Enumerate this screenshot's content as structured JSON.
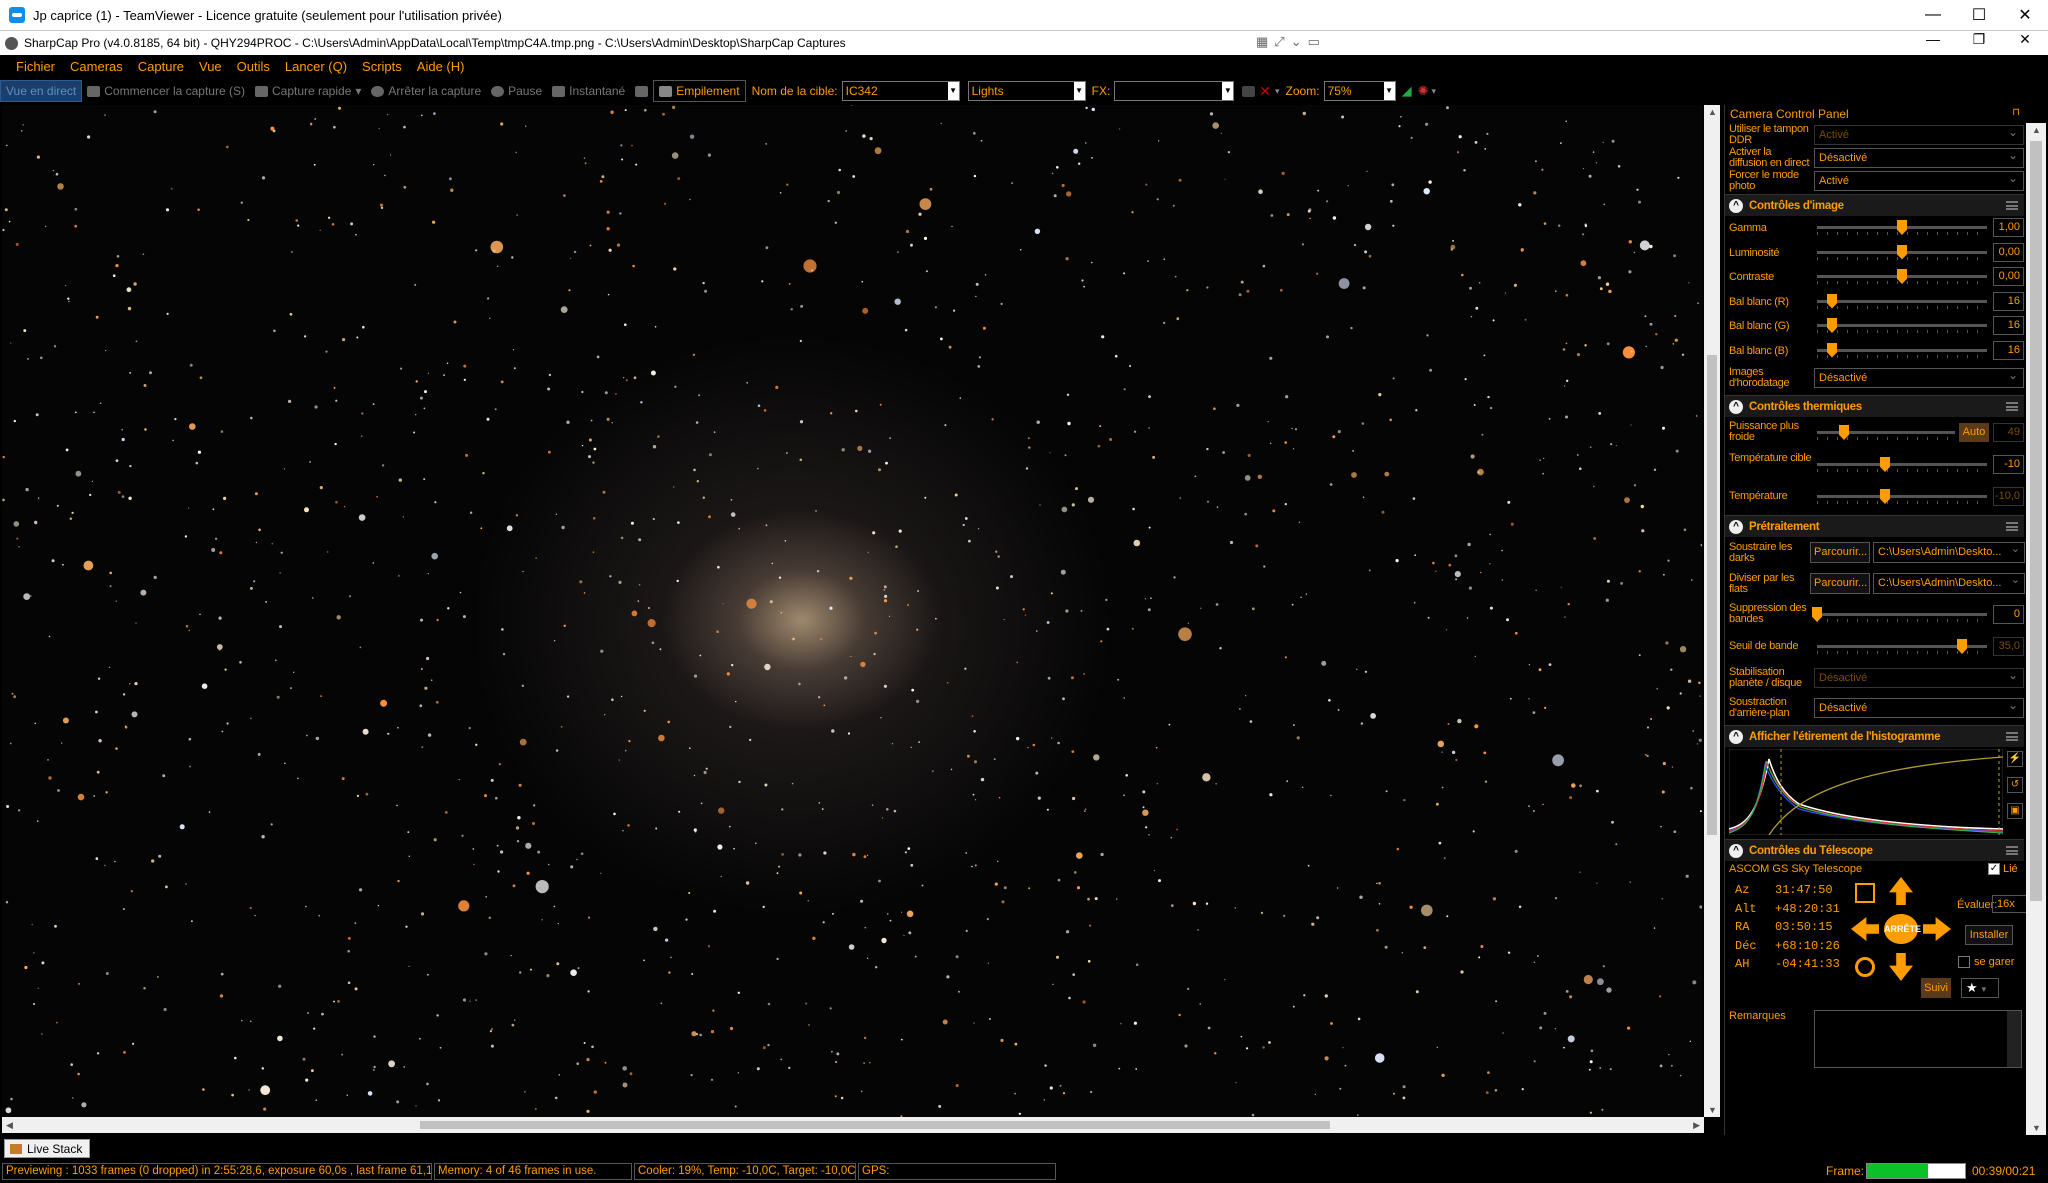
{
  "teamviewer": {
    "title": "Jp caprice (1) - TeamViewer - Licence gratuite (seulement pour l'utilisation privée)"
  },
  "app": {
    "title": "SharpCap Pro (v4.0.8185, 64 bit) - QHY294PROC - C:\\Users\\Admin\\AppData\\Local\\Temp\\tmpC4A.tmp.png - C:\\Users\\Admin\\Desktop\\SharpCap Captures"
  },
  "menu": [
    "Fichier",
    "Cameras",
    "Capture",
    "Vue",
    "Outils",
    "Lancer (Q)",
    "Scripts",
    "Aide (H)"
  ],
  "toolbar": {
    "live_view": "Vue en direct",
    "start_capture": "Commencer la capture (S)",
    "quick_capture": "Capture rapide",
    "stop_capture": "Arrêter la capture",
    "pause": "Pause",
    "snapshot": "Instantané",
    "stacking": "Empilement",
    "target_label": "Nom de la cible:",
    "target_value": "IC342",
    "frame_type": "Lights",
    "fx_label": "FX:",
    "fx_value": "",
    "zoom_label": "Zoom:",
    "zoom_value": "75%"
  },
  "panel": {
    "title": "Camera Control Panel",
    "top_rows": [
      {
        "label": "Utiliser le tampon DDR",
        "value": "Activé",
        "disabled": true
      },
      {
        "label": "Activer la diffusion en direct",
        "value": "Désactivé",
        "disabled": false
      },
      {
        "label": "Forcer le mode photo",
        "value": "Activé",
        "disabled": false
      }
    ],
    "image_controls": {
      "title": "Contrôles d'image",
      "sliders": [
        {
          "label": "Gamma",
          "value": "1,00",
          "pos": 0.5
        },
        {
          "label": "Luminosité",
          "value": "0,00",
          "pos": 0.5
        },
        {
          "label": "Contraste",
          "value": "0,00",
          "pos": 0.5
        },
        {
          "label": "Bal blanc (R)",
          "value": "16",
          "pos": 0.06
        },
        {
          "label": "Bal blanc (G)",
          "value": "16",
          "pos": 0.06
        },
        {
          "label": "Bal blanc (B)",
          "value": "16",
          "pos": 0.06
        }
      ],
      "timestamp_label": "Images d'horodatage",
      "timestamp_value": "Désactivé"
    },
    "thermal": {
      "title": "Contrôles thermiques",
      "cooler_label": "Puissance plus froide",
      "auto_label": "Auto",
      "cooler_value": "49",
      "target_label": "Température cible",
      "target_value": "-10",
      "temp_label": "Température",
      "temp_value": "-10,0"
    },
    "preprocessing": {
      "title": "Prétraitement",
      "darks_label": "Soustraire les darks",
      "browse_label": "Parcourir...",
      "darks_path": "C:\\Users\\Admin\\Deskto...",
      "flats_label": "Diviser par les flats",
      "flats_path": "C:\\Users\\Admin\\Deskto...",
      "banding_label": "Suppression des bandes",
      "banding_value": "0",
      "threshold_label": "Seuil de bande",
      "threshold_value": "35,0",
      "stabilization_label": "Stabilisation planète / disque",
      "stabilization_value": "Désactivé",
      "background_label": "Soustraction d'arrière-plan",
      "background_value": "Désactivé"
    },
    "histogram": {
      "title": "Afficher l'étirement de l'histogramme"
    },
    "telescope": {
      "title": "Contrôles du Télescope",
      "mount": "ASCOM GS Sky Telescope",
      "linked_label": "Lié",
      "coords": [
        {
          "k": "Az",
          "v": "31:47:50"
        },
        {
          "k": "Alt",
          "v": "+48:20:31"
        },
        {
          "k": "RA",
          "v": "03:50:15"
        },
        {
          "k": "Déc",
          "v": "+68:10:26"
        },
        {
          "k": "AH",
          "v": "-04:41:33"
        }
      ],
      "stop_label": "ARRÊTE",
      "rate_label": "Évaluer:",
      "rate_value": "16x",
      "install_label": "Installer",
      "park_label": "se garer",
      "track_label": "Suivi"
    },
    "remarks_label": "Remarques"
  },
  "live_stack_tab": "Live Stack",
  "status": {
    "previewing": "Previewing : 1033 frames (0 dropped) in 2:55:28,6, exposure 60,0s , last frame 61,1s",
    "memory": "Memory: 4 of 46 frames in use.",
    "cooler": "Cooler: 19%, Temp: -10,0C, Target: -10,0C",
    "gps": "GPS:",
    "frame_label": "Frame:",
    "frame_progress": 0.62,
    "frame_time": "00:39/00:21"
  },
  "colors": {
    "accent": "#ff9c00",
    "background": "#000000"
  }
}
